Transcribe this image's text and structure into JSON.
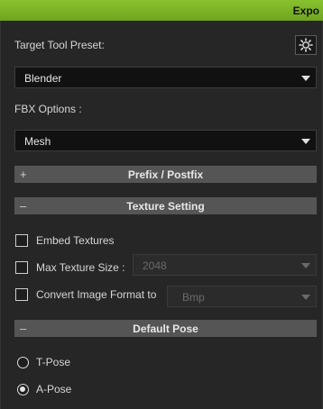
{
  "window": {
    "title": "Expo"
  },
  "preset": {
    "label": "Target Tool Preset:",
    "value": "Blender"
  },
  "fbx": {
    "label": "FBX Options :",
    "value": "Mesh"
  },
  "sections": {
    "prefix": {
      "sign": "+",
      "title": "Prefix / Postfix"
    },
    "texture": {
      "sign": "–",
      "title": "Texture Setting"
    },
    "pose": {
      "sign": "–",
      "title": "Default Pose"
    }
  },
  "texture": {
    "embed": {
      "label": "Embed Textures",
      "checked": false
    },
    "max_size": {
      "label": "Max Texture Size :",
      "checked": false,
      "value": "2048"
    },
    "convert": {
      "label": "Convert Image Format to",
      "checked": false,
      "value": "Bmp"
    }
  },
  "pose": {
    "options": [
      {
        "label": "T-Pose",
        "selected": false
      },
      {
        "label": "A-Pose",
        "selected": true
      }
    ]
  }
}
